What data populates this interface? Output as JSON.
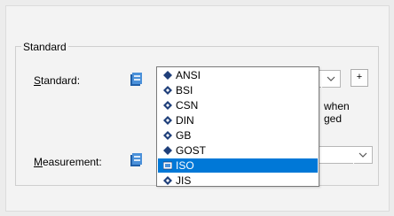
{
  "group": {
    "title": "Standard"
  },
  "standard": {
    "label": "Standard:",
    "mnemonic": "S",
    "rest": "tandard:",
    "plus": "+"
  },
  "measurement": {
    "label": "Measurement:",
    "mnemonic": "M",
    "rest": "easurement:"
  },
  "note": {
    "line1": "when",
    "line2": "ged"
  },
  "dropdown": {
    "items": [
      {
        "label": "ANSI",
        "icon": "diamond-icon"
      },
      {
        "label": "BSI",
        "icon": "standard-icon"
      },
      {
        "label": "CSN",
        "icon": "standard-icon"
      },
      {
        "label": "DIN",
        "icon": "standard-icon"
      },
      {
        "label": "GB",
        "icon": "standard-icon"
      },
      {
        "label": "GOST",
        "icon": "diamond-icon"
      },
      {
        "label": "ISO",
        "icon": "iso-icon",
        "selected": true
      },
      {
        "label": "JIS",
        "icon": "standard-icon"
      }
    ]
  },
  "colors": {
    "selection": "#0078d7",
    "icon_blue": "#1f5fa8"
  }
}
